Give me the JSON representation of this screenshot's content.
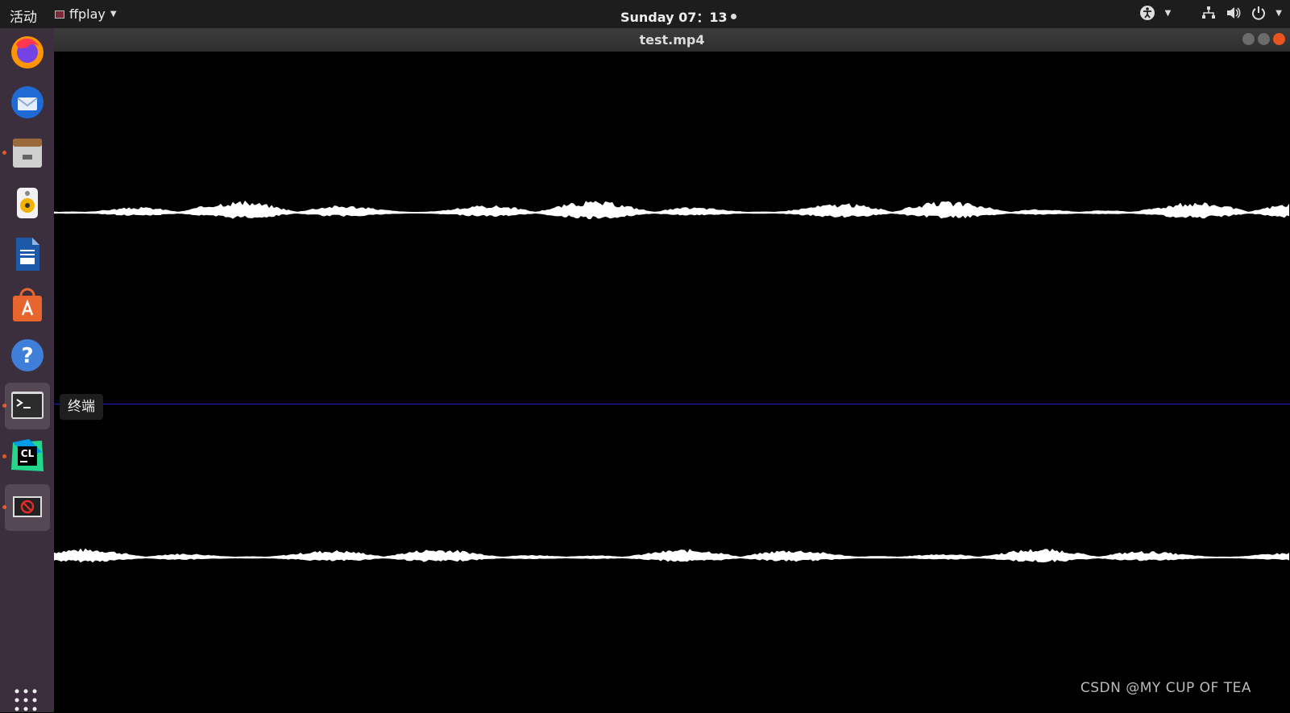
{
  "topbar": {
    "activities": "活动",
    "app_name": "ffplay",
    "clock": "Sunday 07：13"
  },
  "window": {
    "title": "test.mp4"
  },
  "tooltip": "终端",
  "watermark": "CSDN @MY CUP OF TEA",
  "colors": {
    "dock_bg": "#3c2f3d",
    "accent": "#e95420",
    "divider": "#1f1fcf",
    "wave": "#ffffff"
  },
  "dock": {
    "items": [
      {
        "icon": "firefox-icon",
        "running": false,
        "active": false
      },
      {
        "icon": "thunderbird-icon",
        "running": false,
        "active": false
      },
      {
        "icon": "files-icon",
        "running": true,
        "active": false
      },
      {
        "icon": "rhythmbox-icon",
        "running": false,
        "active": false
      },
      {
        "icon": "libreoffice-writer-icon",
        "running": false,
        "active": false
      },
      {
        "icon": "ubuntu-software-icon",
        "running": false,
        "active": false
      },
      {
        "icon": "help-icon",
        "running": false,
        "active": false
      },
      {
        "icon": "terminal-icon",
        "running": true,
        "active": true
      },
      {
        "icon": "clion-icon",
        "running": true,
        "active": false
      },
      {
        "icon": "ffplay-window-icon",
        "running": true,
        "active": true
      }
    ],
    "show_apps_icon": "app-grid-icon"
  }
}
